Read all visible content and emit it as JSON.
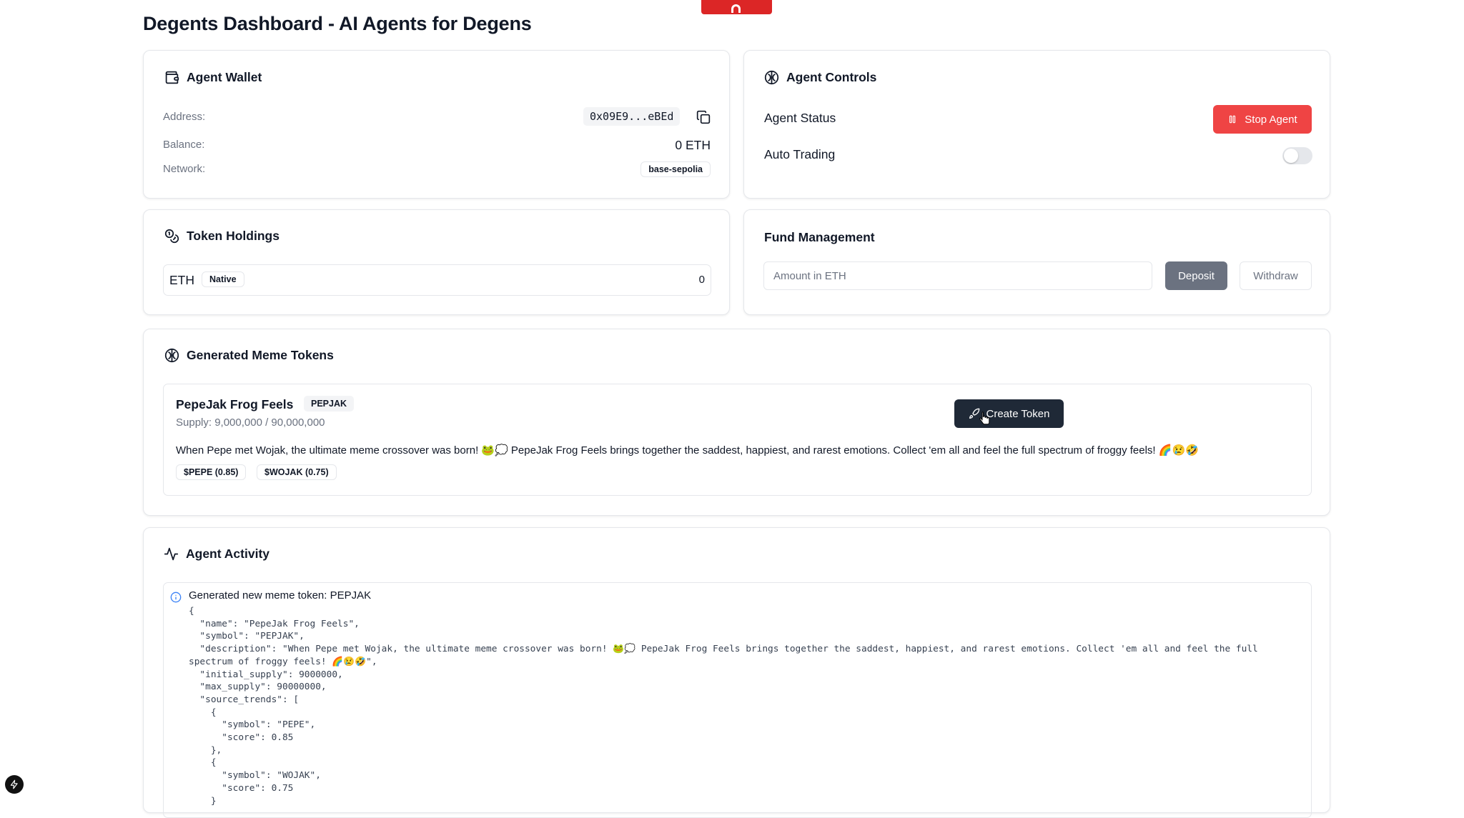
{
  "page": {
    "title": "Degents Dashboard - AI Agents for Degens"
  },
  "wallet": {
    "title": "Agent Wallet",
    "address_label": "Address:",
    "address": "0x09E9...eBEd",
    "balance_label": "Balance:",
    "balance": "0 ETH",
    "network_label": "Network:",
    "network": "base-sepolia"
  },
  "controls": {
    "title": "Agent Controls",
    "status_label": "Agent Status",
    "stop_button": "Stop Agent",
    "auto_trading_label": "Auto Trading",
    "auto_trading_on": false,
    "accent": "#ef4444"
  },
  "holdings": {
    "title": "Token Holdings",
    "items": [
      {
        "symbol": "ETH",
        "badge": "Native",
        "amount": "0"
      }
    ]
  },
  "funds": {
    "title": "Fund Management",
    "amount_placeholder": "Amount in ETH",
    "deposit_button": "Deposit",
    "withdraw_button": "Withdraw"
  },
  "meme_tokens": {
    "title": "Generated Meme Tokens",
    "token": {
      "name": "PepeJak Frog Feels",
      "symbol": "PEPJAK",
      "supply": "Supply: 9,000,000 / 90,000,000",
      "description": "When Pepe met Wojak, the ultimate meme crossover was born! 🐸💭 PepeJak Frog Feels brings together the saddest, happiest, and rarest emotions. Collect 'em all and feel the full spectrum of froggy feels! 🌈😢🤣",
      "trends": [
        "$PEPE (0.85)",
        "$WOJAK (0.75)"
      ],
      "create_button": "Create Token"
    }
  },
  "activity": {
    "title": "Agent Activity",
    "entries": [
      {
        "message": "Generated new meme token: PEPJAK",
        "details": "{\n  \"name\": \"PepeJak Frog Feels\",\n  \"symbol\": \"PEPJAK\",\n  \"description\": \"When Pepe met Wojak, the ultimate meme crossover was born! 🐸💭 PepeJak Frog Feels brings together the saddest, happiest, and rarest emotions. Collect 'em all and feel the full spectrum of froggy feels! 🌈😢🤣\",\n  \"initial_supply\": 9000000,\n  \"max_supply\": 90000000,\n  \"source_trends\": [\n    {\n      \"symbol\": \"PEPE\",\n      \"score\": 0.85\n    },\n    {\n      \"symbol\": \"WOJAK\",\n      \"score\": 0.75\n    }"
      }
    ]
  }
}
